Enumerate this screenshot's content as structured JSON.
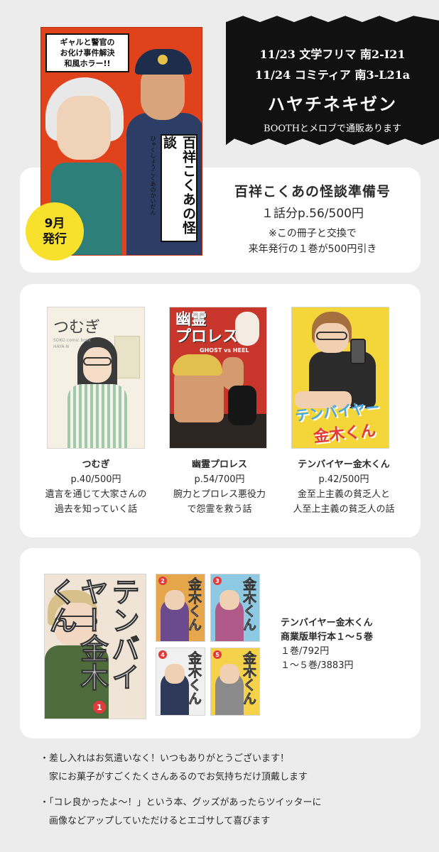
{
  "banner": {
    "event_1": "11/23 文学フリマ 南2-I21",
    "event_2": "11/24 コミティア 南3-L21a",
    "circle_name": "ハヤチネキゼン",
    "shop_note": "BOOTHとメロブで通販あります"
  },
  "main_cover": {
    "tagline": "ギャルと警官の\nお化け事件解決\n和風ホラー!!",
    "title": "百祥こくあの怪談",
    "ruby": "ひゃくしょうこくあのかいだん"
  },
  "release_badge": {
    "line_1": "9月",
    "line_2": "発行"
  },
  "featured": {
    "title": "百祥こくあの怪談準備号",
    "price": "１話分p.56/500円",
    "note_1": "※この冊子と交換で",
    "note_2": "来年発行の１巻が500円引き"
  },
  "books": [
    {
      "cover_title": "つむぎ",
      "cover_small": "SOKO comic book\nHAYA-N",
      "name": "つむぎ",
      "price": "p.40/500円",
      "desc_1": "遺言を通じて大家さんの",
      "desc_2": "過去を知っていく話",
      "accent": "#9fc9a7"
    },
    {
      "cover_title": "幽霊\nプロレス",
      "cover_sub": "GHOST vs HEEL",
      "name": "幽霊プロレス",
      "price": "p.54/700円",
      "desc_1": "腕力とプロレス悪役力",
      "desc_2": "で怨霊を救う話",
      "accent": "#c8352a"
    },
    {
      "cover_title": "テンバイヤー",
      "cover_title_2": "金木くん",
      "name": "テンバイヤー金木くん",
      "price": "p.42/500円",
      "desc_1": "金至上主義の貧乏人と",
      "desc_2": "人至上主義の貧乏人の話",
      "accent": "#f4d63a"
    }
  ],
  "commercial": {
    "cover_title": "テンバイヤー金木くん",
    "cover_title_short": "金木くん",
    "volumes": [
      "1",
      "2",
      "3",
      "4",
      "5"
    ],
    "name": "テンバイヤー金木くん",
    "subtitle": "商業版単行本１～５巻",
    "price_single": "１巻/792円",
    "price_set": "１～５巻/3883円"
  },
  "notes": [
    {
      "line_1": "・差し入れはお気遣いなく！いつもありがとうございます！",
      "line_2": "　家にお菓子がすごくたくさんあるのでお気持ちだけ頂戴します"
    },
    {
      "line_1": "・「コレ良かったよ～！」という本、グッズがあったらツイッターに",
      "line_2": "　画像などアップしていただけるとエゴサして喜びます"
    }
  ],
  "colors": {
    "background": "#ececec",
    "banner": "#111111",
    "badge": "#f7e12c",
    "cover_main": "#e0421c"
  }
}
